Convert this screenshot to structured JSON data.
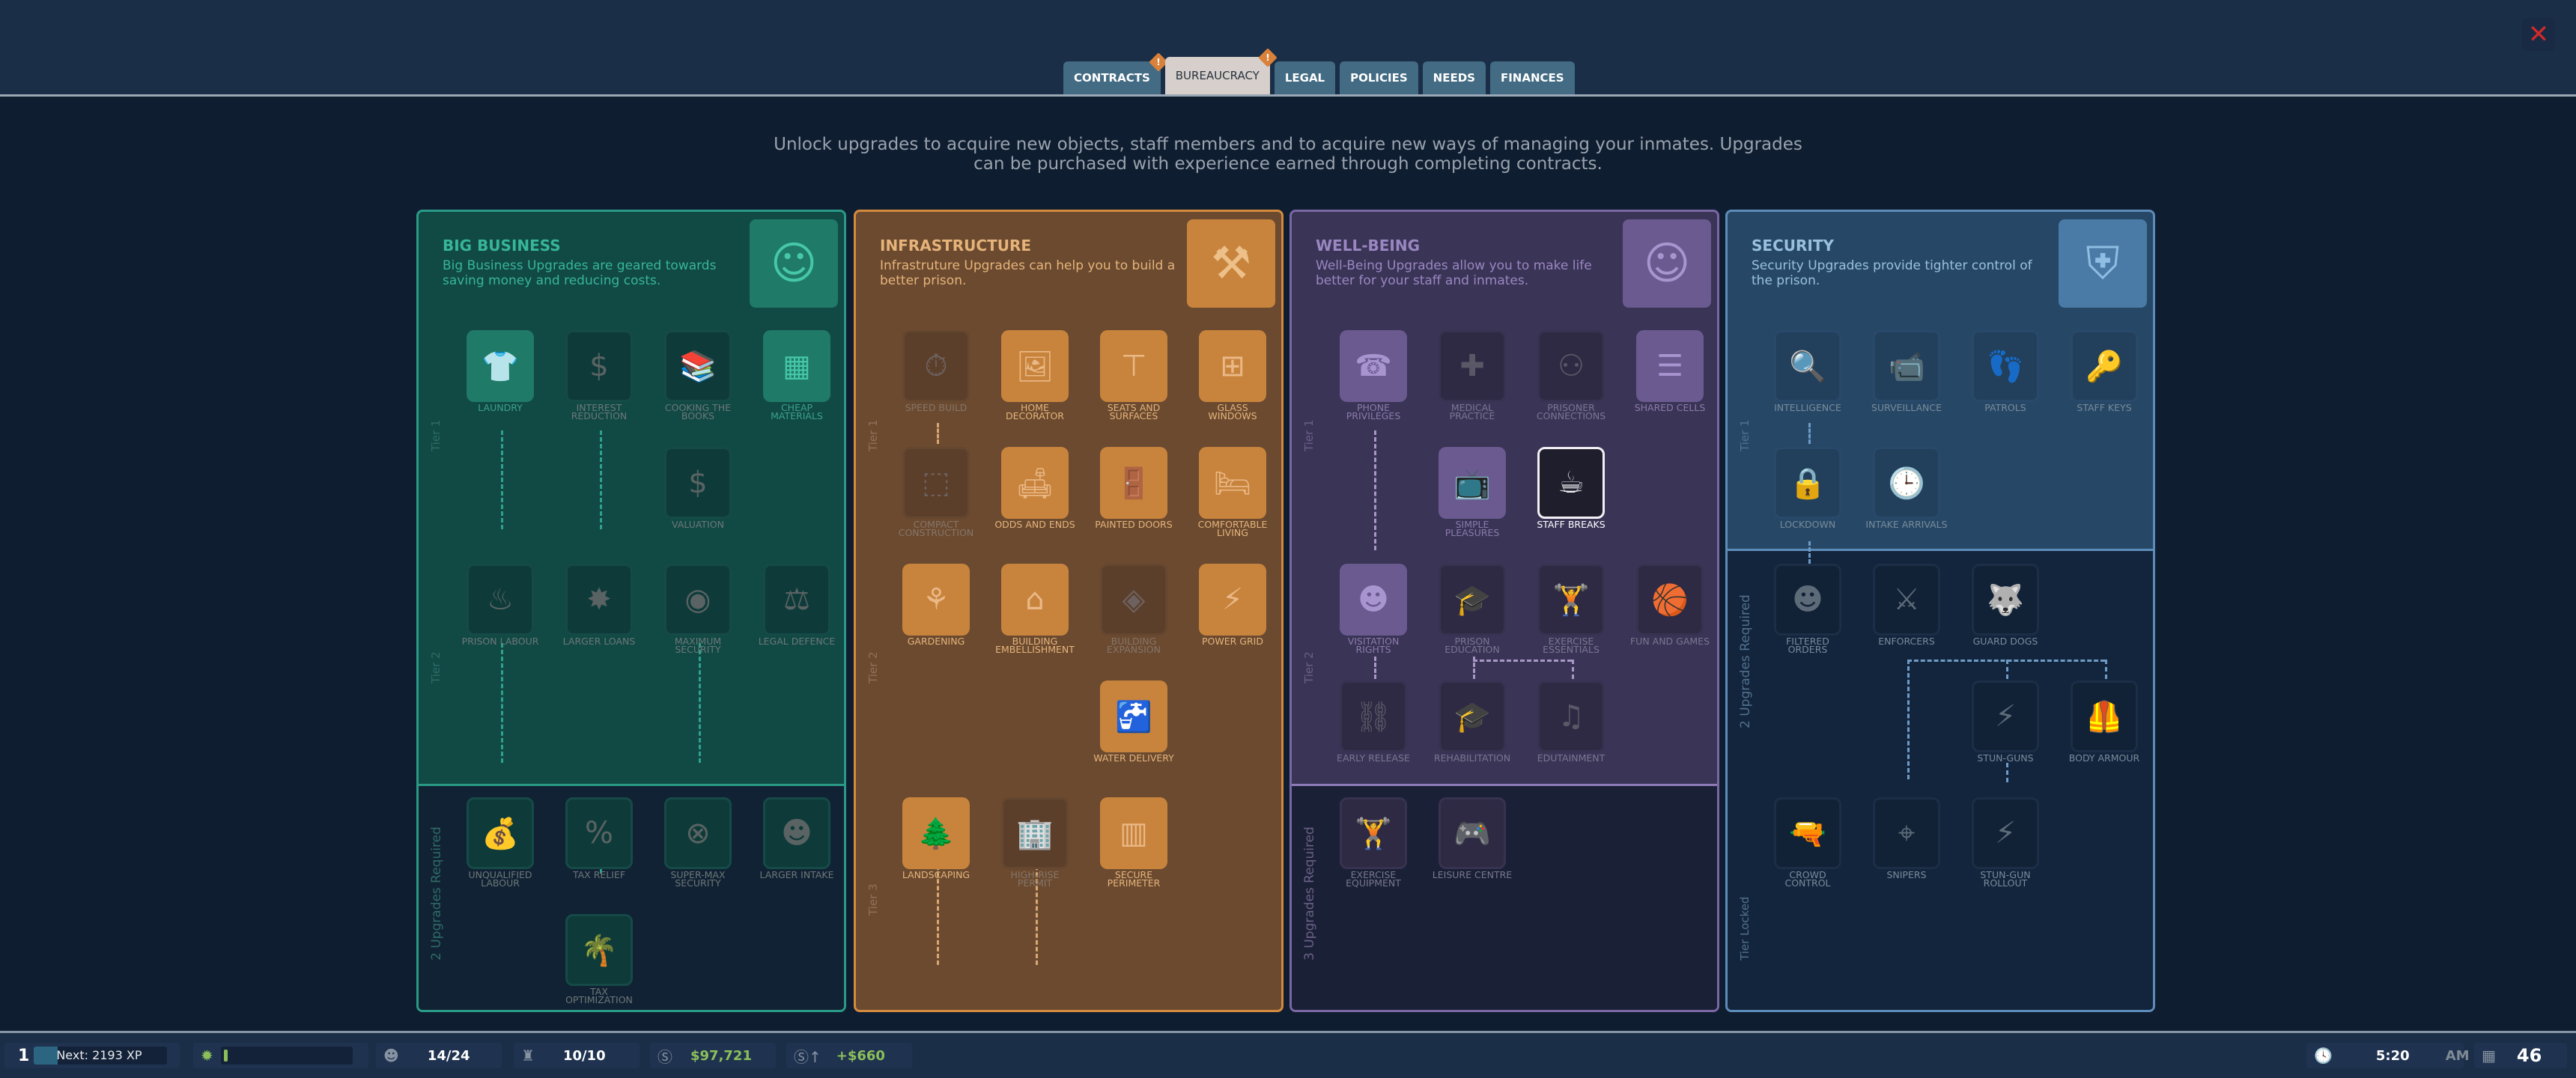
{
  "tabs": [
    {
      "label": "CONTRACTS",
      "alert": true,
      "active": false
    },
    {
      "label": "BUREAUCRACY",
      "alert": true,
      "active": true
    },
    {
      "label": "LEGAL",
      "alert": false,
      "active": false
    },
    {
      "label": "POLICIES",
      "alert": false,
      "active": false
    },
    {
      "label": "NEEDS",
      "alert": false,
      "active": false
    },
    {
      "label": "FINANCES",
      "alert": false,
      "active": false
    }
  ],
  "alert_glyph": "!",
  "close_glyph": "✕",
  "intro": "Unlock upgrades to acquire new objects, staff members and to acquire new ways of managing your inmates. Upgrades can be purchased with experience earned through completing contracts.",
  "categories": {
    "big_business": {
      "title": "BIG BUSINESS",
      "desc": "Big Business Upgrades are geared towards saving money and reducing costs.",
      "color": "#2a9a86",
      "tier1": "Tier 1",
      "tier2": "Tier 2",
      "locked": "2 Upgrades Required",
      "nodes": {
        "laundry": "LAUNDRY",
        "interest_reduction": "INTEREST REDUCTION",
        "cooking_books": "COOKING THE BOOKS",
        "cheap_materials": "CHEAP MATERIALS",
        "valuation": "VALUATION",
        "prison_labour": "PRISON LABOUR",
        "larger_loans": "LARGER LOANS",
        "maximum_security": "MAXIMUM SECURITY",
        "legal_defence": "LEGAL DEFENCE",
        "unqualified_labour": "UNQUALIFIED LABOUR",
        "tax_relief": "TAX RELIEF",
        "super_max": "SUPER-MAX SECURITY",
        "larger_intake": "LARGER INTAKE",
        "tax_optimization": "TAX OPTIMIZATION"
      }
    },
    "infrastructure": {
      "title": "INFRASTRUCTURE",
      "desc": "Infrastruture Upgrades can help you to build a better prison.",
      "color": "#d48a3e",
      "tier1": "Tier 1",
      "tier2": "Tier 2",
      "tier3": "Tier 3",
      "nodes": {
        "speed_build": "SPEED BUILD",
        "home_decorator": "HOME DECORATOR",
        "seats_surfaces": "SEATS AND SURFACES",
        "glass_windows": "GLASS WINDOWS",
        "compact_construction": "COMPACT CONSTRUCTION",
        "odds_ends": "ODDS AND ENDS",
        "painted_doors": "PAINTED DOORS",
        "comfortable_living": "COMFORTABLE LIVING",
        "gardening": "GARDENING",
        "building_embellishment": "BUILDING EMBELLISHMENT",
        "building_expansion": "BUILDING EXPANSION",
        "power_grid": "POWER GRID",
        "water_delivery": "WATER DELIVERY",
        "landscaping": "LANDSCAPING",
        "high_rise": "HIGH-RISE PERMIT",
        "secure_perimeter": "SECURE PERIMETER"
      }
    },
    "well_being": {
      "title": "WELL-BEING",
      "desc": "Well-Being Upgrades allow you to make life better for your staff and inmates.",
      "color": "#7a67a4",
      "tier1": "Tier 1",
      "tier2": "Tier 2",
      "locked": "3 Upgrades Required",
      "nodes": {
        "phone_privileges": "PHONE PRIVILEGES",
        "medical_practice": "MEDICAL PRACTICE",
        "prisoner_connections": "PRISONER CONNECTIONS",
        "shared_cells": "SHARED CELLS",
        "simple_pleasures": "SIMPLE PLEASURES",
        "staff_breaks": "STAFF BREAKS",
        "visitation_rights": "VISITATION RIGHTS",
        "prison_education": "PRISON EDUCATION",
        "exercise_essentials": "EXERCISE ESSENTIALS",
        "fun_games": "FUN AND GAMES",
        "early_release": "EARLY RELEASE",
        "rehabilitation": "REHABILITATION",
        "edutainment": "EDUTAINMENT",
        "exercise_equipment": "EXERCISE EQUIPMENT",
        "leisure_centre": "LEISURE CENTRE"
      }
    },
    "security": {
      "title": "SECURITY",
      "desc": "Security Upgrades provide tighter control of the prison.",
      "color": "#5d8cba",
      "tier1": "Tier 1",
      "locked": "2 Upgrades Required",
      "tier_locked": "Tier Locked",
      "nodes": {
        "intelligence": "INTELLIGENCE",
        "surveillance": "SURVEILLANCE",
        "patrols": "PATROLS",
        "staff_keys": "STAFF KEYS",
        "lockdown": "LOCKDOWN",
        "intake_arrivals": "INTAKE ARRIVALS",
        "filtered_orders": "FILTERED ORDERS",
        "enforcers": "ENFORCERS",
        "guard_dogs": "GUARD DOGS",
        "stun_guns": "STUN-GUNS",
        "body_armour": "BODY ARMOUR",
        "crowd_control": "CROWD CONTROL",
        "snipers": "SNIPERS",
        "stun_gun_rollout": "STUN-GUN ROLLOUT"
      }
    }
  },
  "status": {
    "level": "1",
    "xp_text": "Next: 2193 XP",
    "xp_progress": 0.18,
    "inmates": "14/24",
    "staff": "10/10",
    "balance": "$97,721",
    "income": "+$660",
    "time": "5:20",
    "ampm": "AM",
    "day": "46"
  }
}
